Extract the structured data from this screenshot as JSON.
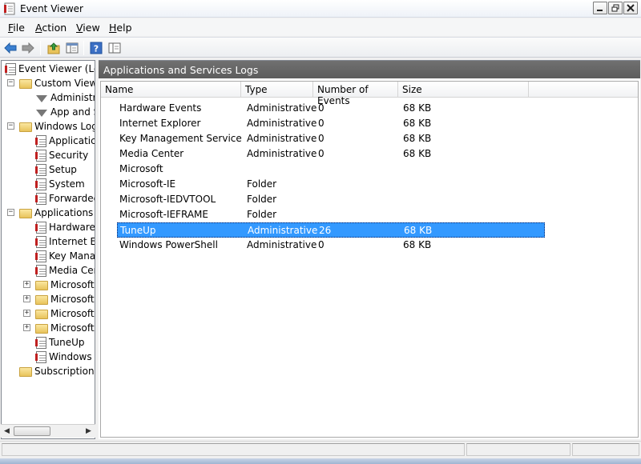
{
  "window": {
    "title": "Event Viewer"
  },
  "menu": [
    {
      "first": "F",
      "rest": "ile"
    },
    {
      "first": "A",
      "rest": "ction"
    },
    {
      "first": "V",
      "rest": "iew"
    },
    {
      "first": "H",
      "rest": "elp"
    }
  ],
  "toolbar": {
    "icons": [
      "back-arrow-icon",
      "forward-arrow-icon",
      "up-folder-icon",
      "show-hide-tree-icon",
      "help-icon",
      "properties-icon"
    ]
  },
  "tree": {
    "items": [
      {
        "label": "Event Viewer (Loc",
        "icon": "event-viewer-icon",
        "expander": ""
      },
      {
        "label": "Custom View",
        "icon": "folder-icon",
        "expander": "−"
      },
      {
        "label": "Administr",
        "icon": "filter-icon",
        "expander": ""
      },
      {
        "label": "App and S",
        "icon": "filter-icon",
        "expander": ""
      },
      {
        "label": "Windows Log",
        "icon": "folder-icon",
        "expander": "−"
      },
      {
        "label": "Applicatic",
        "icon": "log-icon",
        "expander": ""
      },
      {
        "label": "Security",
        "icon": "log-icon",
        "expander": ""
      },
      {
        "label": "Setup",
        "icon": "log-icon",
        "expander": ""
      },
      {
        "label": "System",
        "icon": "log-icon",
        "expander": ""
      },
      {
        "label": "Forwardec",
        "icon": "log-icon",
        "expander": ""
      },
      {
        "label": "Applications a",
        "icon": "folder-icon",
        "expander": "−"
      },
      {
        "label": "Hardware",
        "icon": "log-icon",
        "expander": ""
      },
      {
        "label": "Internet Ex",
        "icon": "log-icon",
        "expander": ""
      },
      {
        "label": "Key Mana",
        "icon": "log-icon",
        "expander": ""
      },
      {
        "label": "Media Cer",
        "icon": "log-icon",
        "expander": ""
      },
      {
        "label": "Microsoft",
        "icon": "folder-icon",
        "expander": "+"
      },
      {
        "label": "Microsoft",
        "icon": "folder-icon",
        "expander": "+"
      },
      {
        "label": "Microsoft",
        "icon": "folder-icon",
        "expander": "+"
      },
      {
        "label": "Microsoft",
        "icon": "folder-icon",
        "expander": "+"
      },
      {
        "label": "TuneUp",
        "icon": "log-icon",
        "expander": ""
      },
      {
        "label": "Windows",
        "icon": "log-icon",
        "expander": ""
      },
      {
        "label": "Subscriptions",
        "icon": "folder-icon",
        "expander": ""
      }
    ]
  },
  "main": {
    "header": "Applications and Services Logs",
    "columns": [
      "Name",
      "Type",
      "Number of Events",
      "Size"
    ],
    "rows": [
      {
        "name": "Hardware Events",
        "type": "Administrative",
        "events": "0",
        "size": "68 KB"
      },
      {
        "name": "Internet Explorer",
        "type": "Administrative",
        "events": "0",
        "size": "68 KB"
      },
      {
        "name": "Key Management Service",
        "type": "Administrative",
        "events": "0",
        "size": "68 KB"
      },
      {
        "name": "Media Center",
        "type": "Administrative",
        "events": "0",
        "size": "68 KB"
      },
      {
        "name": "Microsoft",
        "type": "",
        "events": "",
        "size": ""
      },
      {
        "name": "Microsoft-IE",
        "type": "Folder",
        "events": "",
        "size": ""
      },
      {
        "name": "Microsoft-IEDVTOOL",
        "type": "Folder",
        "events": "",
        "size": ""
      },
      {
        "name": "Microsoft-IEFRAME",
        "type": "Folder",
        "events": "",
        "size": ""
      },
      {
        "name": "TuneUp",
        "type": "Administrative",
        "events": "26",
        "size": "68 KB"
      },
      {
        "name": "Windows PowerShell",
        "type": "Administrative",
        "events": "0",
        "size": "68 KB"
      }
    ],
    "selected_row": 8
  },
  "colors": {
    "header_bg": "#646464",
    "selection": "#3399ff"
  }
}
